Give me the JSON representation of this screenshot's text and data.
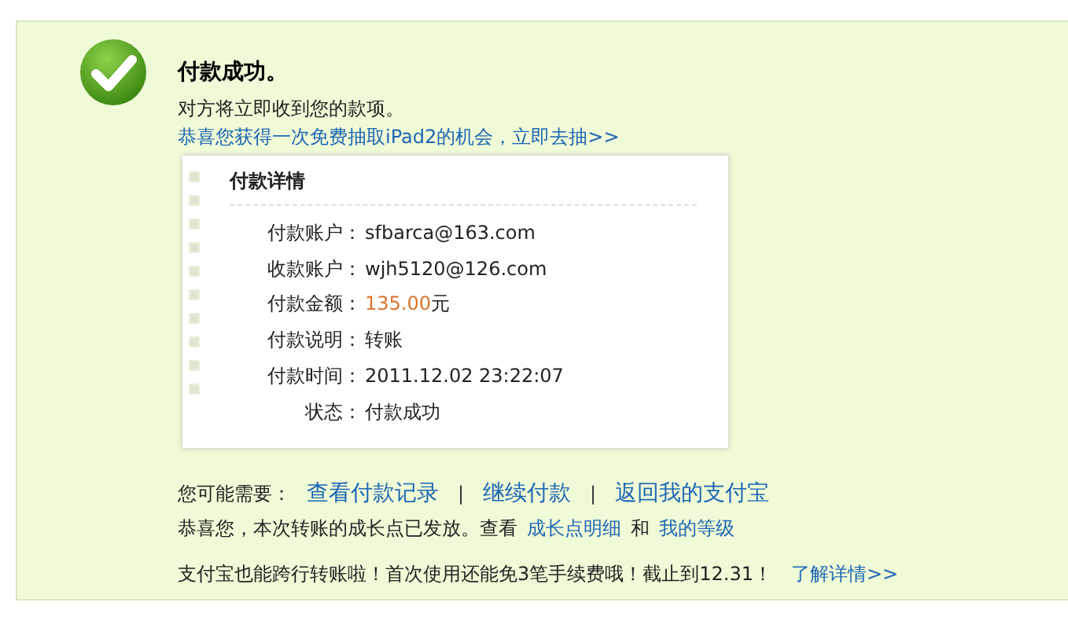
{
  "result": {
    "title": "付款成功。",
    "message": "对方将立即收到您的款项。",
    "promo_link": "恭喜您获得一次免费抽取iPad2的机会，立即去抽>>"
  },
  "details": {
    "title": "付款详情",
    "rows": [
      {
        "label": "付款账户：",
        "value": "sfbarca@163.com",
        "kind": "plain"
      },
      {
        "label": "收款账户：",
        "value": "wjh5120@126.com",
        "kind": "plain"
      },
      {
        "label": "付款金额：",
        "value": "135.00",
        "unit": "元",
        "kind": "amount"
      },
      {
        "label": "付款说明：",
        "value": "转账",
        "kind": "plain"
      },
      {
        "label": "付款时间：",
        "value": "2011.12.02 23:22:07",
        "kind": "plain"
      },
      {
        "label": "状态：",
        "value": "付款成功",
        "kind": "plain"
      }
    ]
  },
  "next_steps": {
    "label": "您可能需要：",
    "links": [
      "查看付款记录",
      "继续付款",
      "返回我的支付宝"
    ],
    "separator": "|"
  },
  "growth": {
    "text": "恭喜您，本次转账的成长点已发放。查看",
    "link_1": "成长点明细",
    "joiner": "和",
    "link_2": "我的等级"
  },
  "notice": {
    "text": "支付宝也能跨行转账啦！首次使用还能免3笔手续费哦！截止到12.31！",
    "link": "了解详情>>"
  }
}
